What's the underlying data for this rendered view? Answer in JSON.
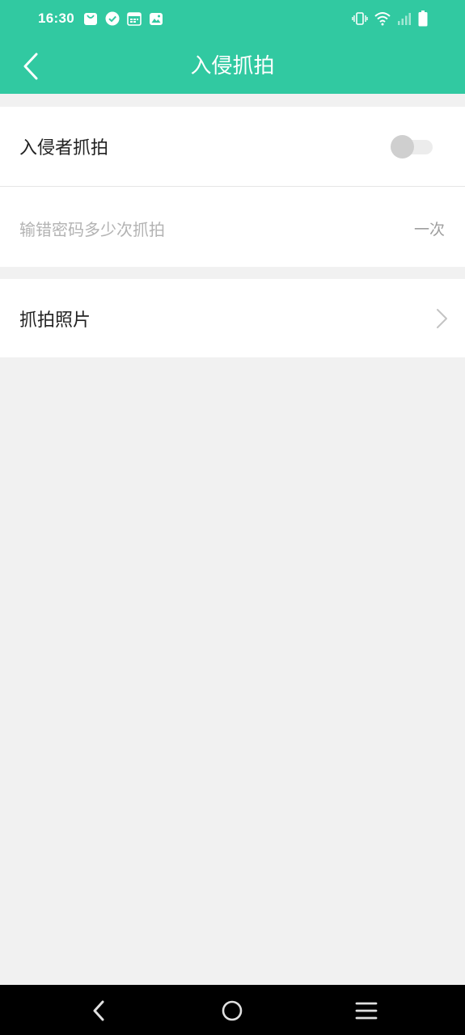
{
  "status_bar": {
    "time": "16:30",
    "notification_icons": [
      "shopping-bag-icon",
      "check-circle-icon",
      "calendar-icon",
      "image-icon"
    ],
    "system_icons": [
      "vibrate-icon",
      "wifi-icon",
      "signal-icon",
      "battery-icon"
    ]
  },
  "header": {
    "title": "入侵抓拍",
    "accent_color": "#31c9a1"
  },
  "settings": {
    "intruder_capture": {
      "label": "入侵者抓拍",
      "enabled": false
    },
    "wrong_password_attempts": {
      "label": "输错密码多少次抓拍",
      "value": "一次"
    },
    "captured_photos": {
      "label": "抓拍照片"
    }
  },
  "nav_bar": {
    "icons": [
      "back-icon",
      "home-icon",
      "menu-icon"
    ]
  }
}
